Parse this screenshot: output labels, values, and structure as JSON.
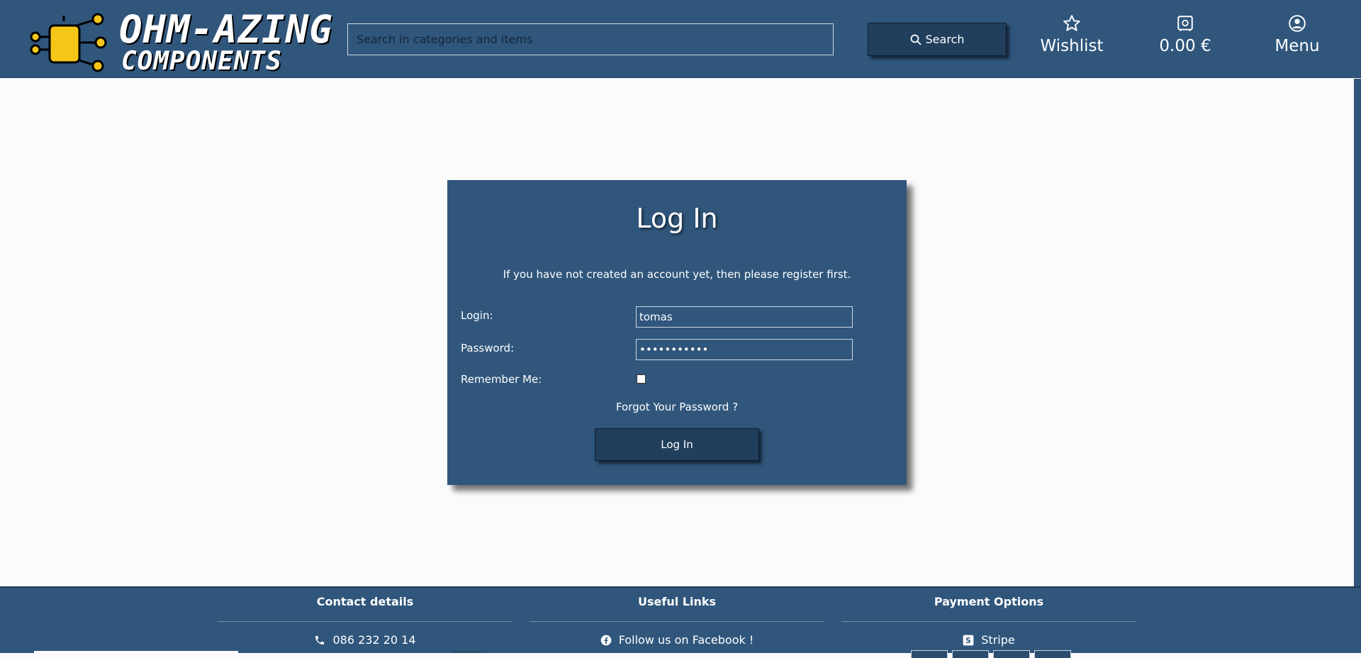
{
  "header": {
    "logo_line1": "OHM-AZING",
    "logo_line2": "COMPONENTS",
    "search_placeholder": "Search in categories and items",
    "search_label": "Search",
    "wishlist_label": "Wishlist",
    "cart_label": "0.00 €",
    "menu_label": "Menu"
  },
  "login": {
    "title": "Log In",
    "note": "If you have not created an account yet, then please register first.",
    "login_label": "Login:",
    "login_value": "tomas",
    "password_label": "Password:",
    "password_value": "•••••••••••",
    "remember_label": "Remember Me:",
    "remember_checked": false,
    "forgot_label": "Forgot Your Password ?",
    "submit_label": "Log In"
  },
  "footer": {
    "contact_title": "Contact details",
    "phone": "086 232 20 14",
    "links_title": "Useful Links",
    "facebook": "Follow us on Facebook !",
    "payment_title": "Payment Options",
    "stripe": "Stripe"
  },
  "colors": {
    "brand": "#30567c",
    "button": "#213e5c",
    "background": "#fbfbfb",
    "logo_yellow": "#f5c518"
  }
}
